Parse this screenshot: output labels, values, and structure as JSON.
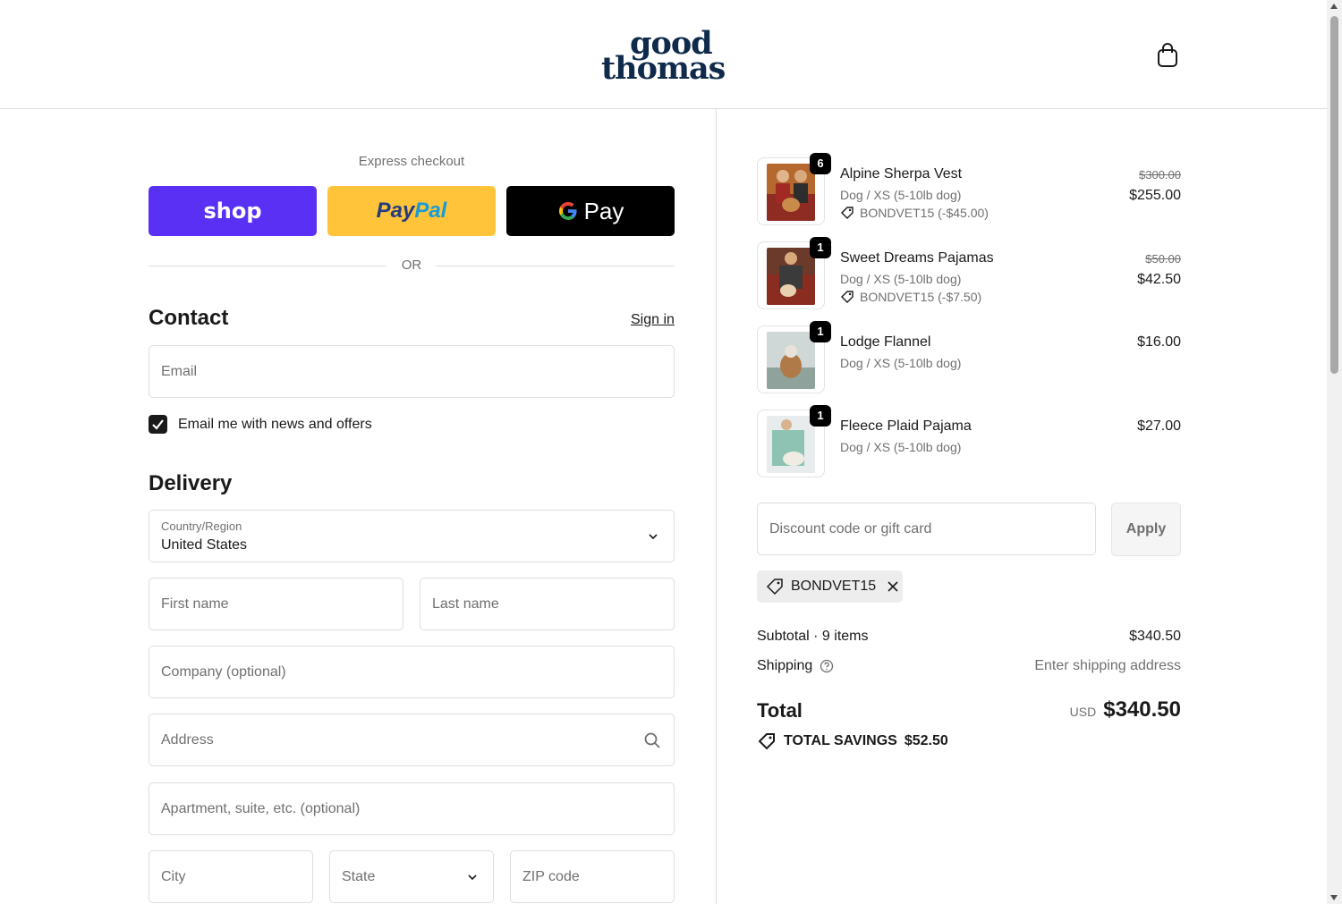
{
  "header": {
    "logo_line1": "good",
    "logo_line2": "thomas",
    "cart_icon": "shopping-bag-icon"
  },
  "express": {
    "label": "Express checkout",
    "shop_label": "shop",
    "paypal_part1": "Pay",
    "paypal_part2": "Pal",
    "gpay_g": "G",
    "gpay_label": "Pay",
    "or_label": "OR"
  },
  "contact": {
    "title": "Contact",
    "sign_in": "Sign in",
    "email_placeholder": "Email",
    "newsletter_label": "Email me with news and offers",
    "newsletter_checked": true
  },
  "delivery": {
    "title": "Delivery",
    "country_label": "Country/Region",
    "country_value": "United States",
    "first_name": "First name",
    "last_name": "Last name",
    "company": "Company (optional)",
    "address": "Address",
    "apartment": "Apartment, suite, etc. (optional)",
    "city": "City",
    "state": "State",
    "zip": "ZIP code"
  },
  "order": {
    "items": [
      {
        "name": "Alpine Sherpa Vest",
        "variant": "Dog / XS (5-10lb dog)",
        "discount": "BONDVET15 (-$45.00)",
        "original": "$300.00",
        "price": "$255.00",
        "qty": "6"
      },
      {
        "name": "Sweet Dreams Pajamas",
        "variant": "Dog / XS (5-10lb dog)",
        "discount": "BONDVET15 (-$7.50)",
        "original": "$50.00",
        "price": "$42.50",
        "qty": "1"
      },
      {
        "name": "Lodge Flannel",
        "variant": "Dog / XS (5-10lb dog)",
        "price": "$16.00",
        "qty": "1"
      },
      {
        "name": "Fleece Plaid Pajama",
        "variant": "Dog / XS (5-10lb dog)",
        "price": "$27.00",
        "qty": "1"
      }
    ],
    "discount_placeholder": "Discount code or gift card",
    "apply_label": "Apply",
    "applied_code": "BONDVET15",
    "subtotal_label": "Subtotal · 9 items",
    "subtotal_value": "$340.50",
    "shipping_label": "Shipping",
    "shipping_value": "Enter shipping address",
    "total_label": "Total",
    "total_currency": "USD",
    "total_value": "$340.50",
    "savings_label": "TOTAL SAVINGS",
    "savings_value": "$52.50"
  },
  "colors": {
    "shop": "#5a31f4",
    "paypal": "#ffc439",
    "gpay": "#000000",
    "logo": "#0f2a4a"
  }
}
